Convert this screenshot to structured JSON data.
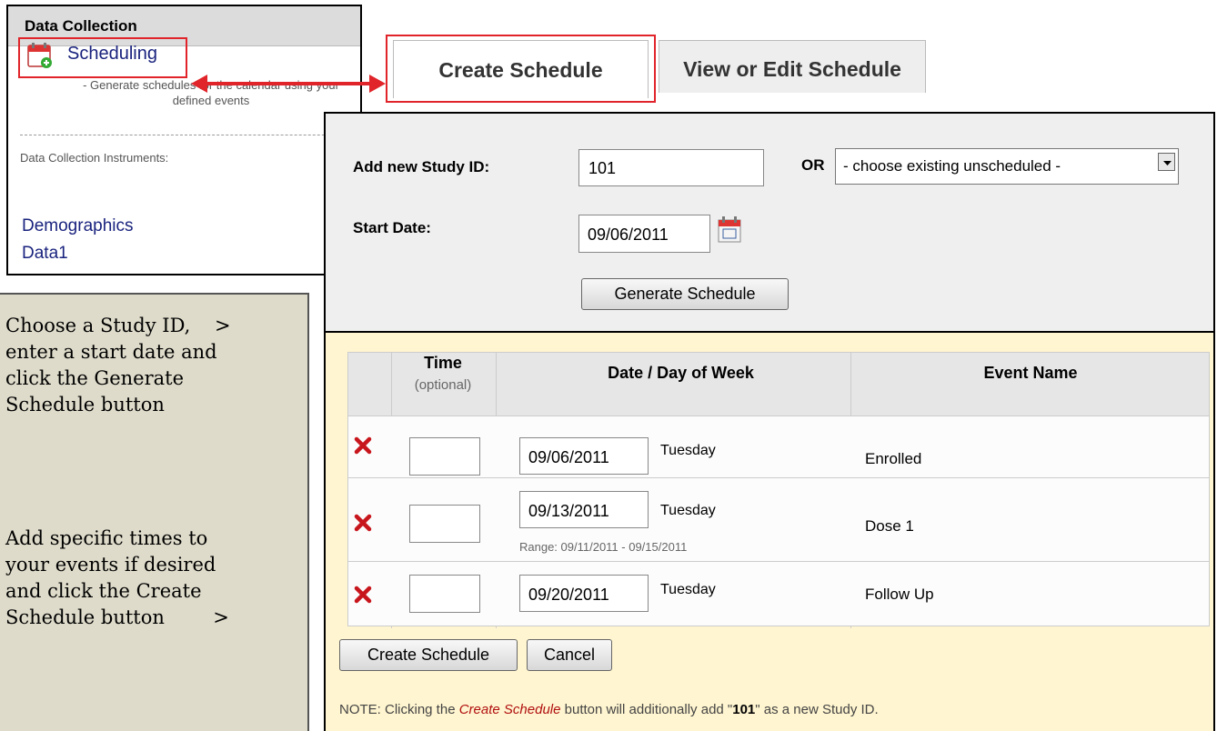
{
  "left_panel": {
    "header": "Data Collection",
    "scheduling_link": "Scheduling",
    "scheduling_desc": "- Generate schedules for the calendar using your defined events",
    "instruments_label": "Data Collection Instruments:",
    "instruments": [
      "Demographics",
      "Data1"
    ]
  },
  "tabs": [
    {
      "label": "Create Schedule",
      "active": true
    },
    {
      "label": "View or Edit Schedule",
      "active": false
    }
  ],
  "form": {
    "study_id_label": "Add new Study ID:",
    "study_id_value": "101",
    "or_label": "OR",
    "existing_select": "- choose existing unscheduled -",
    "start_date_label": "Start Date:",
    "start_date_value": "09/06/2011",
    "generate_button": "Generate Schedule"
  },
  "schedule": {
    "headers": {
      "time": "Time",
      "time_note": "(optional)",
      "date": "Date / Day of Week",
      "event": "Event Name"
    },
    "rows": [
      {
        "date": "09/06/2011",
        "day": "Tuesday",
        "event": "Enrolled",
        "range": ""
      },
      {
        "date": "09/13/2011",
        "day": "Tuesday",
        "event": "Dose 1",
        "range": "Range: 09/11/2011 - 09/15/2011"
      },
      {
        "date": "09/20/2011",
        "day": "Tuesday",
        "event": "Follow Up",
        "range": ""
      }
    ],
    "create_button": "Create Schedule",
    "cancel_button": "Cancel",
    "note_prefix": "NOTE: Clicking the ",
    "note_em": "Create Schedule",
    "note_mid": " button will additionally add \"",
    "note_bold": "101",
    "note_suffix": "\" as a new Study ID."
  },
  "instructions": {
    "step1": "Choose a Study ID,    >\nenter a start date and\nclick the Generate\nSchedule button",
    "step2": "Add specific times to\nyour events if desired\nand click the Create\nSchedule button        >"
  },
  "colors": {
    "highlight_red": "#e0242a",
    "link_blue": "#1a237e",
    "schedule_bg": "#fff5d0",
    "instruction_bg": "#dedbca",
    "delete_red": "#c8161d"
  }
}
